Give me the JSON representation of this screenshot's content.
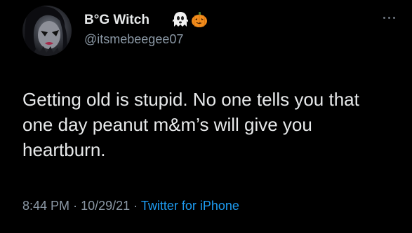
{
  "tweet": {
    "display_name": "B°G Witch",
    "name_emojis": [
      "ghost-emoji",
      "jack-o-lantern-emoji"
    ],
    "handle": "@itsmebeegee07",
    "text": "Getting old is stupid. No one tells you that one day peanut m&m’s will give you heartburn.",
    "time": "8:44 PM",
    "separator": "·",
    "date": "10/29/21",
    "source": "Twitter for iPhone"
  },
  "colors": {
    "background": "#000000",
    "text": "#e7e9ea",
    "secondary": "#8b98a5",
    "link": "#1d9bf0"
  },
  "icons": {
    "more": "more-options-icon"
  }
}
